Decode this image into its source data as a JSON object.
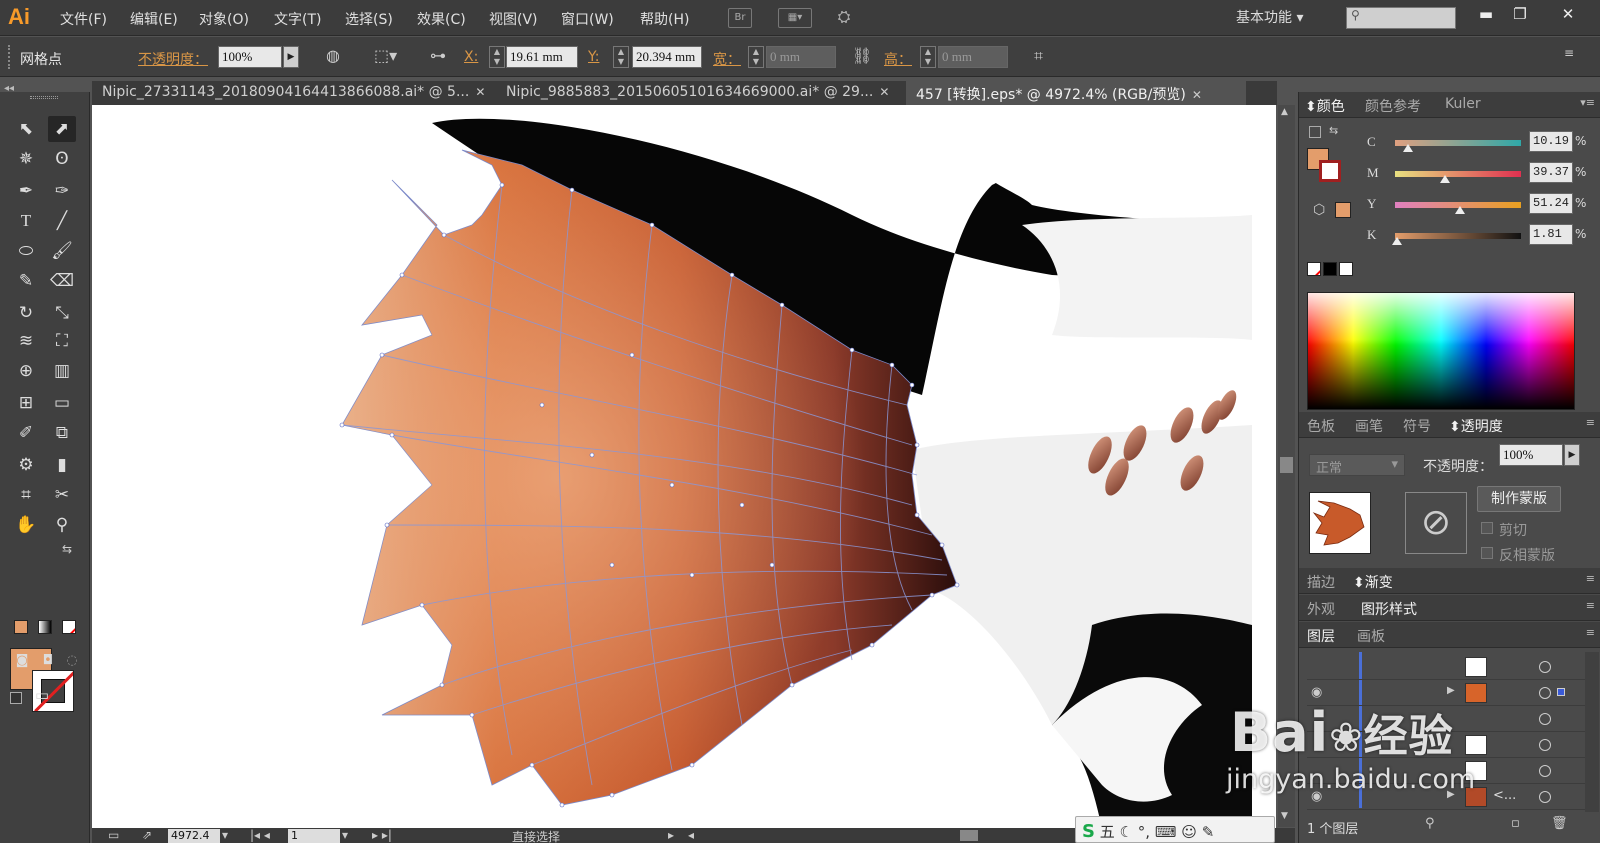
{
  "app": {
    "logo": "Ai",
    "brand_color": "#f79a2a"
  },
  "menu": {
    "items": [
      "文件(F)",
      "编辑(E)",
      "对象(O)",
      "文字(T)",
      "选择(S)",
      "效果(C)",
      "视图(V)",
      "窗口(W)",
      "帮助(H)"
    ],
    "bridge_label": "Br",
    "workspace": "基本功能"
  },
  "control": {
    "mode_label": "网格点",
    "opacity_label": "不透明度：",
    "opacity_value": "100%",
    "x_label": "X:",
    "x_value": "19.61 mm",
    "y_label": "Y:",
    "y_value": "20.394 mm",
    "w_label": "宽：",
    "w_value": "0 mm",
    "h_label": "高：",
    "h_value": "0 mm"
  },
  "tabs": [
    {
      "title": "Nipic_27331143_20180904164413866088.ai* @ 5..."
    },
    {
      "title": "Nipic_9885883_20150605101634669000.ai* @ 29..."
    },
    {
      "title": "457 [转换].eps* @ 4972.4% (RGB/预览)"
    }
  ],
  "tools": {
    "fill_color": "#e39d6b",
    "icons": [
      "selection-tool",
      "direct-selection-tool",
      "magic-wand-tool",
      "lasso-tool",
      "pen-tool",
      "curvature-tool",
      "type-tool",
      "line-tool",
      "ellipse-tool",
      "paintbrush-tool",
      "pencil-tool",
      "eraser-tool",
      "rotate-tool",
      "scale-tool",
      "warp-tool",
      "free-transform-tool",
      "shape-builder-tool",
      "perspective-tool",
      "mesh-tool",
      "gradient-tool",
      "eyedropper-tool",
      "blend-tool",
      "symbol-sprayer-tool",
      "graph-tool",
      "artboard-tool",
      "slice-tool",
      "hand-tool",
      "zoom-tool"
    ]
  },
  "color_panel": {
    "tabs": [
      "颜色",
      "颜色参考",
      "Kuler"
    ],
    "swatch_color": "#e39d6b",
    "sliders": [
      {
        "label": "C",
        "value": "10.19",
        "fraction": 0.1019,
        "gradient": "linear-gradient(to right,#e0a080,#2fa8a8)"
      },
      {
        "label": "M",
        "value": "39.37",
        "fraction": 0.3937,
        "gradient": "linear-gradient(to right,#e8e080,#e03050)"
      },
      {
        "label": "Y",
        "value": "51.24",
        "fraction": 0.5124,
        "gradient": "linear-gradient(to right,#e080c0,#e8a020)"
      },
      {
        "label": "K",
        "value": "1.81",
        "fraction": 0.0181,
        "gradient": "linear-gradient(to right,#e39d6b,#111111)"
      }
    ],
    "percent": "%"
  },
  "transparency_panel": {
    "tabs": [
      "色板",
      "画笔",
      "符号",
      "透明度"
    ],
    "blend_mode": "正常",
    "opacity_label": "不透明度：",
    "opacity_value": "100%",
    "make_mask": "制作蒙版",
    "clip": "剪切",
    "invert_mask": "反相蒙版"
  },
  "stroke_tabs": [
    "描边",
    "渐变"
  ],
  "appearance_tabs": [
    "外观",
    "图形样式"
  ],
  "layers_panel": {
    "tabs": [
      "图层",
      "画板"
    ],
    "last_row_label": "<...",
    "footer": "1 个图层"
  },
  "status": {
    "zoom": "4972.4",
    "artboard": "1",
    "tool_name": "直接选择"
  },
  "watermark": {
    "logo": "Bai",
    "logo_cn": "经验",
    "url": "jingyan.baidu.com"
  },
  "ime": {
    "s": "S",
    "mode": "五"
  }
}
